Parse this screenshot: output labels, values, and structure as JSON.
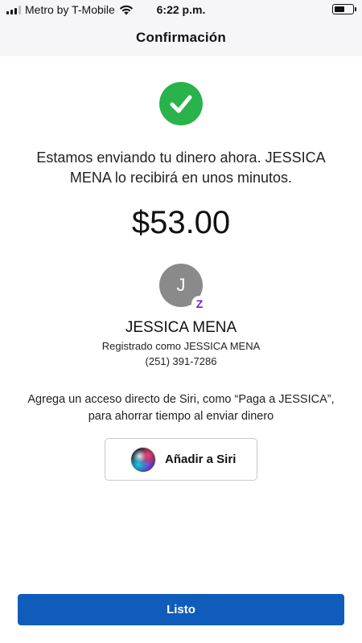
{
  "status_bar": {
    "carrier": "Metro by T-Mobile",
    "time": "6:22 p.m.",
    "battery_level": 0.55
  },
  "nav": {
    "title": "Confirmación"
  },
  "confirmation": {
    "message": "Estamos enviando tu dinero ahora. JESSICA MENA lo recibirá en unos minutos.",
    "amount": "$53.00"
  },
  "recipient": {
    "initial": "J",
    "badge": "Z",
    "name": "JESSICA MENA",
    "registered_as": "Registrado como JESSICA MENA",
    "phone": "(251) 391-7286"
  },
  "siri": {
    "prompt": "Agrega un acceso directo de Siri, como “Paga a JESSICA”, para ahorrar tiempo al enviar dinero",
    "button_label": "Añadir a Siri"
  },
  "footer": {
    "done_label": "Listo"
  },
  "colors": {
    "success": "#2ab24b",
    "primary": "#0f5cba",
    "zelle": "#6d1ed4",
    "avatar": "#8a8a8a"
  }
}
